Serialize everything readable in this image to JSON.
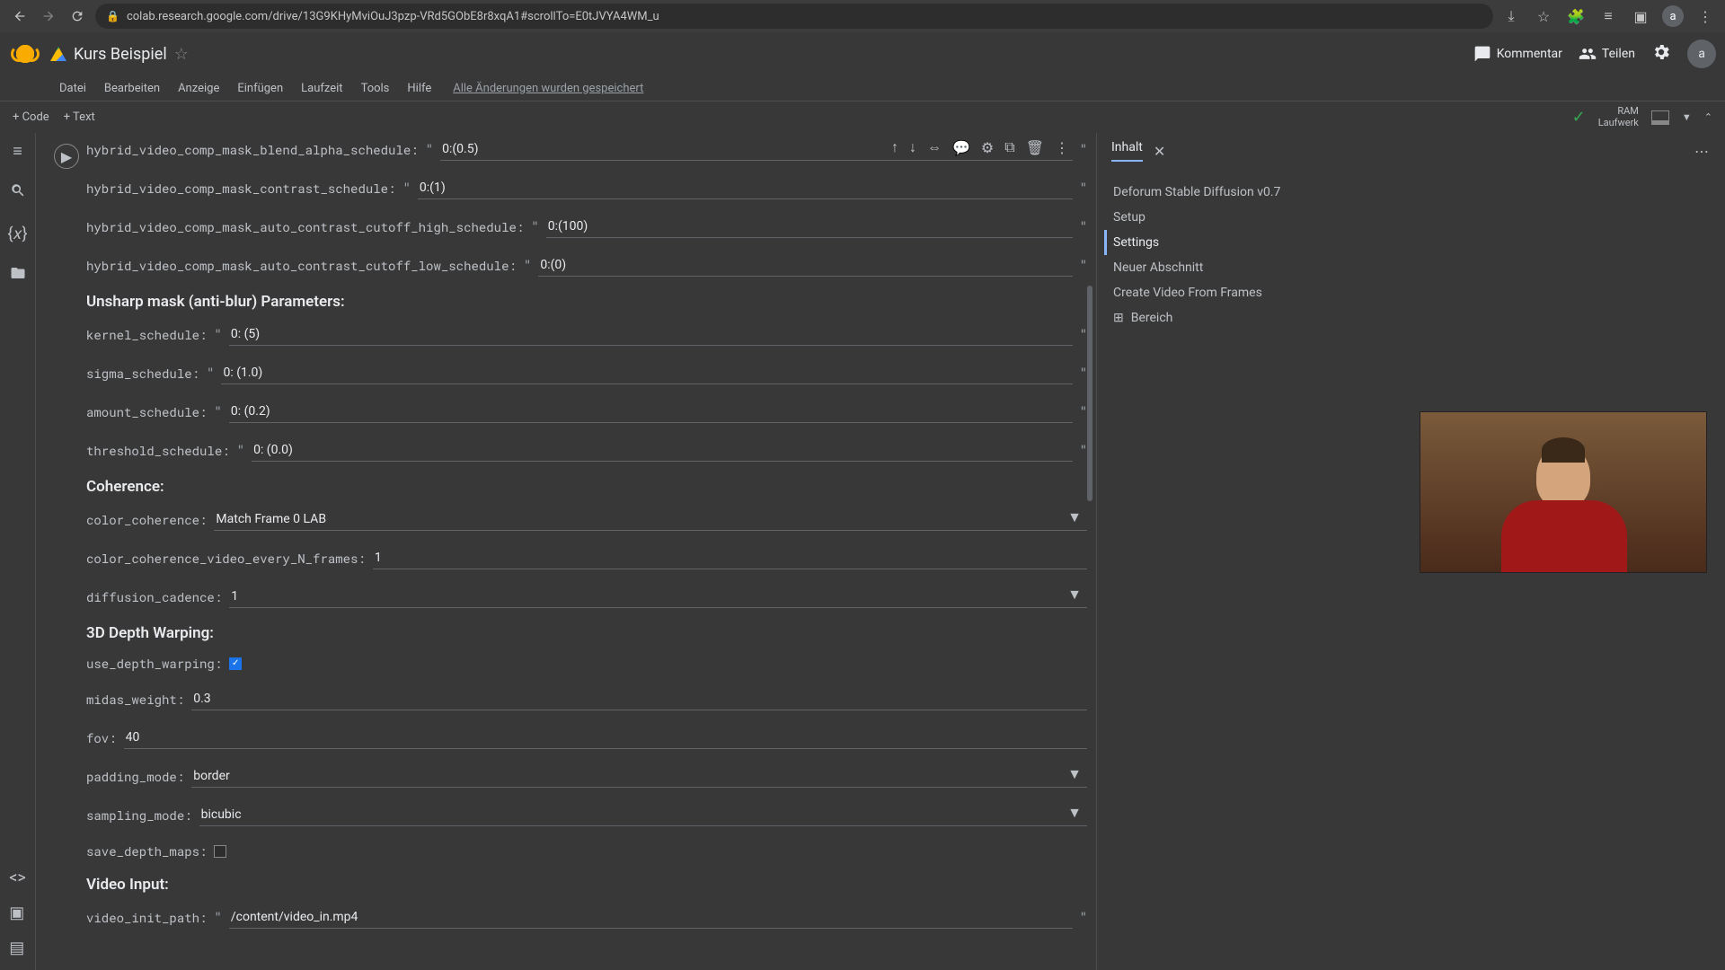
{
  "browser": {
    "url": "colab.research.google.com/drive/13G9KHyMviOuJ3pzp-VRd5GObE8r8xqA1#scrollTo=E0tJVYA4WM_u"
  },
  "header": {
    "title": "Kurs Beispiel",
    "kommentar": "Kommentar",
    "teilen": "Teilen",
    "avatar": "a"
  },
  "menu": {
    "datei": "Datei",
    "bearbeiten": "Bearbeiten",
    "anzeige": "Anzeige",
    "einfugen": "Einfügen",
    "laufzeit": "Laufzeit",
    "tools": "Tools",
    "hilfe": "Hilfe",
    "saved": "Alle Änderungen wurden gespeichert"
  },
  "toolbar": {
    "code": "+ Code",
    "text": "+ Text",
    "ram": "RAM",
    "laufwerk": "Laufwerk"
  },
  "panel": {
    "tab": "Inhalt",
    "toc": [
      "Deforum Stable Diffusion v0.7",
      "Setup",
      "Settings",
      "Neuer Abschnitt",
      "Create Video From Frames"
    ],
    "bereich": "Bereich"
  },
  "sections": {
    "unsharp": "Unsharp mask (anti-blur) Parameters:",
    "coherence": "Coherence:",
    "depth": "3D Depth Warping:",
    "video": "Video Input:"
  },
  "form": {
    "blend_alpha": {
      "label": "hybrid_video_comp_mask_blend_alpha_schedule:",
      "value": "0:(0.5)"
    },
    "contrast": {
      "label": "hybrid_video_comp_mask_contrast_schedule:",
      "value": "0:(1)"
    },
    "cutoff_high": {
      "label": "hybrid_video_comp_mask_auto_contrast_cutoff_high_schedule:",
      "value": "0:(100)"
    },
    "cutoff_low": {
      "label": "hybrid_video_comp_mask_auto_contrast_cutoff_low_schedule:",
      "value": "0:(0)"
    },
    "kernel": {
      "label": "kernel_schedule:",
      "value": "0: (5)"
    },
    "sigma": {
      "label": "sigma_schedule:",
      "value": "0: (1.0)"
    },
    "amount": {
      "label": "amount_schedule:",
      "value": "0: (0.2)"
    },
    "threshold": {
      "label": "threshold_schedule:",
      "value": "0: (0.0)"
    },
    "color_coherence": {
      "label": "color_coherence:",
      "value": "Match Frame 0 LAB"
    },
    "color_n_frames": {
      "label": "color_coherence_video_every_N_frames:",
      "value": "1"
    },
    "diffusion_cadence": {
      "label": "diffusion_cadence:",
      "value": "1"
    },
    "use_depth": {
      "label": "use_depth_warping:"
    },
    "midas": {
      "label": "midas_weight:",
      "value": "0.3"
    },
    "fov": {
      "label": "fov:",
      "value": "40"
    },
    "padding": {
      "label": "padding_mode:",
      "value": "border"
    },
    "sampling": {
      "label": "sampling_mode:",
      "value": "bicubic"
    },
    "save_depth": {
      "label": "save_depth_maps:"
    },
    "video_path": {
      "label": "video_init_path:",
      "value": "/content/video_in.mp4"
    }
  }
}
